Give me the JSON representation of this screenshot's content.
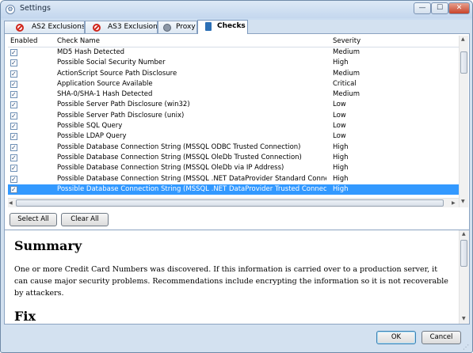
{
  "window": {
    "title": "Settings",
    "min": "—",
    "max": "☐",
    "close": "✕"
  },
  "tabs": [
    {
      "label": "AS2 Exclusions",
      "icon": "no-entry-icon",
      "active": false
    },
    {
      "label": "AS3 Exclusions",
      "icon": "no-entry-icon",
      "active": false
    },
    {
      "label": "Proxy",
      "icon": "proxy-icon",
      "active": false
    },
    {
      "label": "Checks",
      "icon": "checks-icon",
      "active": true
    }
  ],
  "grid": {
    "headers": {
      "enabled": "Enabled",
      "name": "Check Name",
      "severity": "Severity"
    },
    "rows": [
      {
        "name": "MD5 Hash Detected",
        "severity": "Medium",
        "checked": true
      },
      {
        "name": "Possible Social Security Number",
        "severity": "High",
        "checked": true
      },
      {
        "name": "ActionScript Source Path Disclosure",
        "severity": "Medium",
        "checked": true
      },
      {
        "name": "Application Source Available",
        "severity": "Critical",
        "checked": true
      },
      {
        "name": "SHA-0/SHA-1 Hash Detected",
        "severity": "Medium",
        "checked": true
      },
      {
        "name": "Possible Server Path Disclosure (win32)",
        "severity": "Low",
        "checked": true
      },
      {
        "name": "Possible Server Path Disclosure (unix)",
        "severity": "Low",
        "checked": true
      },
      {
        "name": "Possible SQL Query",
        "severity": "Low",
        "checked": true
      },
      {
        "name": "Possible LDAP Query",
        "severity": "Low",
        "checked": true
      },
      {
        "name": "Possible Database Connection String (MSSQL ODBC Trusted Connection)",
        "severity": "High",
        "checked": true
      },
      {
        "name": "Possible Database Connection String (MSSQL OleDb Trusted Connection)",
        "severity": "High",
        "checked": true
      },
      {
        "name": "Possible Database Connection String (MSSQL OleDb via IP Address)",
        "severity": "High",
        "checked": true
      },
      {
        "name": "Possible Database Connection String (MSSQL .NET DataProvider Standard Connec...",
        "severity": "High",
        "checked": true
      },
      {
        "name": "Possible Database Connection String (MSSQL .NET DataProvider Trusted Connecti...",
        "severity": "High",
        "checked": true,
        "selected": true
      }
    ]
  },
  "buttons": {
    "select_all": "Select All",
    "clear_all": "Clear All",
    "ok": "OK",
    "cancel": "Cancel"
  },
  "description": {
    "summary_heading": "Summary",
    "summary_text": "One or more Credit Card Numbers was discovered. If this information is carried over to a production server, it can cause major security problems. Recommendations include encrypting the information so it is not recoverable by attackers.",
    "fix_heading": "Fix"
  },
  "colors": {
    "selection": "#3399ff",
    "close_button": "#c8432a",
    "no_entry": "#d0261c"
  }
}
